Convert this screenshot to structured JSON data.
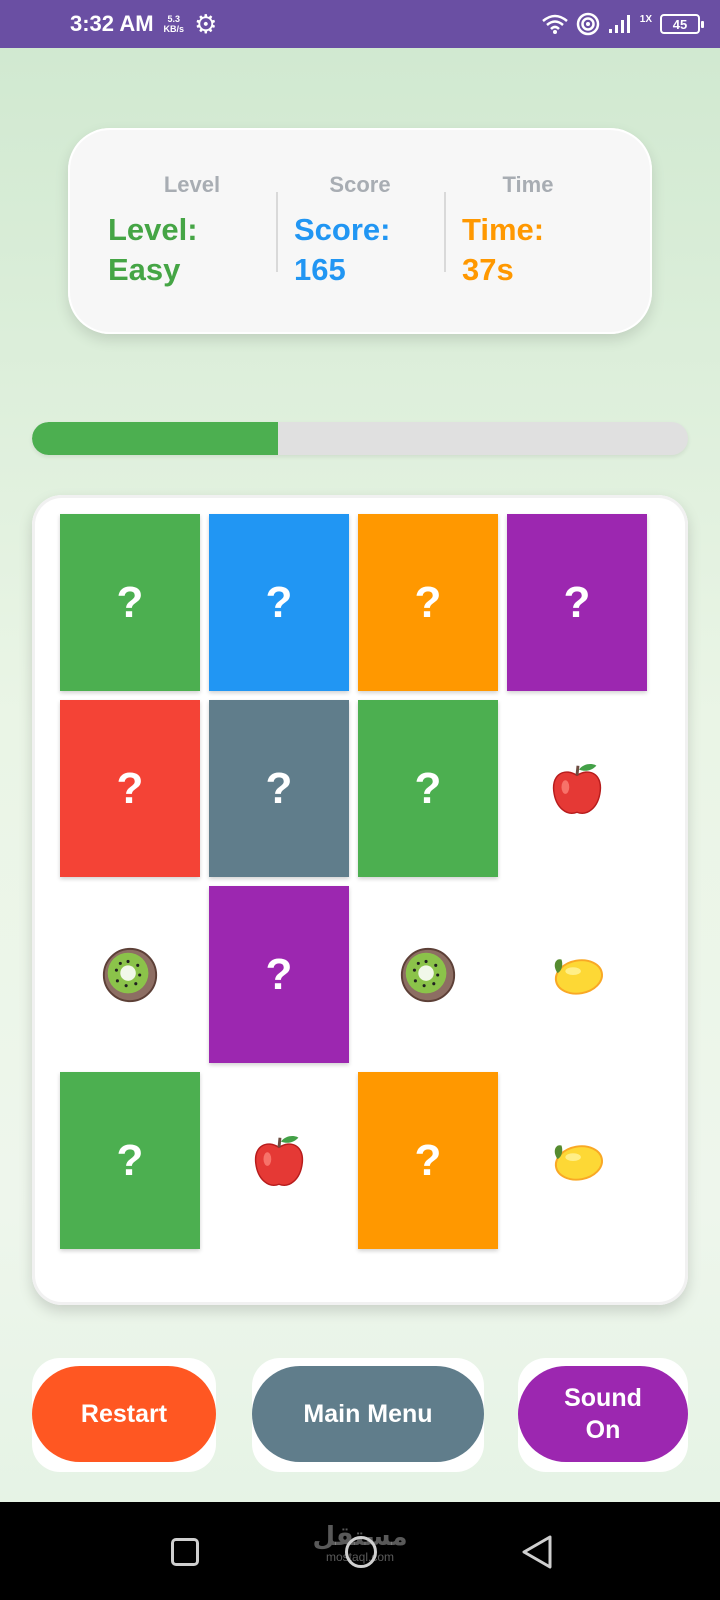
{
  "status_bar": {
    "time": "3:32 AM",
    "speed_value": "5.3",
    "speed_unit": "KB/s",
    "rate_label": "1X",
    "battery": "45",
    "icons": [
      "gear-icon",
      "wifi-icon",
      "hotspot-icon",
      "signal-icon",
      "battery-icon"
    ]
  },
  "stats": {
    "level_caption": "Level",
    "level_value": "Level: Easy",
    "score_caption": "Score",
    "score_value": "Score: 165",
    "time_caption": "Time",
    "time_value": "Time: 37s"
  },
  "progress": {
    "fraction": 0.375,
    "color": "#4caf50"
  },
  "colors": {
    "green": "#4caf50",
    "blue": "#2196f3",
    "orange": "#ff9800",
    "purple": "#9c27b0",
    "red": "#f44336",
    "slate": "#607d8b"
  },
  "board": {
    "hidden_symbol": "?",
    "cards": [
      {
        "state": "hidden",
        "color": "#4caf50"
      },
      {
        "state": "hidden",
        "color": "#2196f3"
      },
      {
        "state": "hidden",
        "color": "#ff9800"
      },
      {
        "state": "hidden",
        "color": "#9c27b0"
      },
      {
        "state": "hidden",
        "color": "#f44336"
      },
      {
        "state": "hidden",
        "color": "#607d8b"
      },
      {
        "state": "hidden",
        "color": "#4caf50"
      },
      {
        "state": "revealed",
        "fruit": "apple"
      },
      {
        "state": "revealed",
        "fruit": "kiwi"
      },
      {
        "state": "hidden",
        "color": "#9c27b0"
      },
      {
        "state": "revealed",
        "fruit": "kiwi"
      },
      {
        "state": "revealed",
        "fruit": "lemon"
      },
      {
        "state": "hidden",
        "color": "#4caf50"
      },
      {
        "state": "revealed",
        "fruit": "apple"
      },
      {
        "state": "hidden",
        "color": "#ff9800"
      },
      {
        "state": "revealed",
        "fruit": "lemon"
      }
    ]
  },
  "buttons": {
    "restart": {
      "label": "Restart",
      "color": "#ff5722"
    },
    "main_menu": {
      "label": "Main Menu",
      "color": "#607d8b"
    },
    "sound": {
      "label": "Sound On",
      "color": "#9c27b0"
    }
  },
  "nav_bar": {
    "icons": [
      "recents-icon",
      "home-icon",
      "back-icon"
    ],
    "watermark_arabic": "مستقل",
    "watermark_url": "mostaql.com"
  }
}
